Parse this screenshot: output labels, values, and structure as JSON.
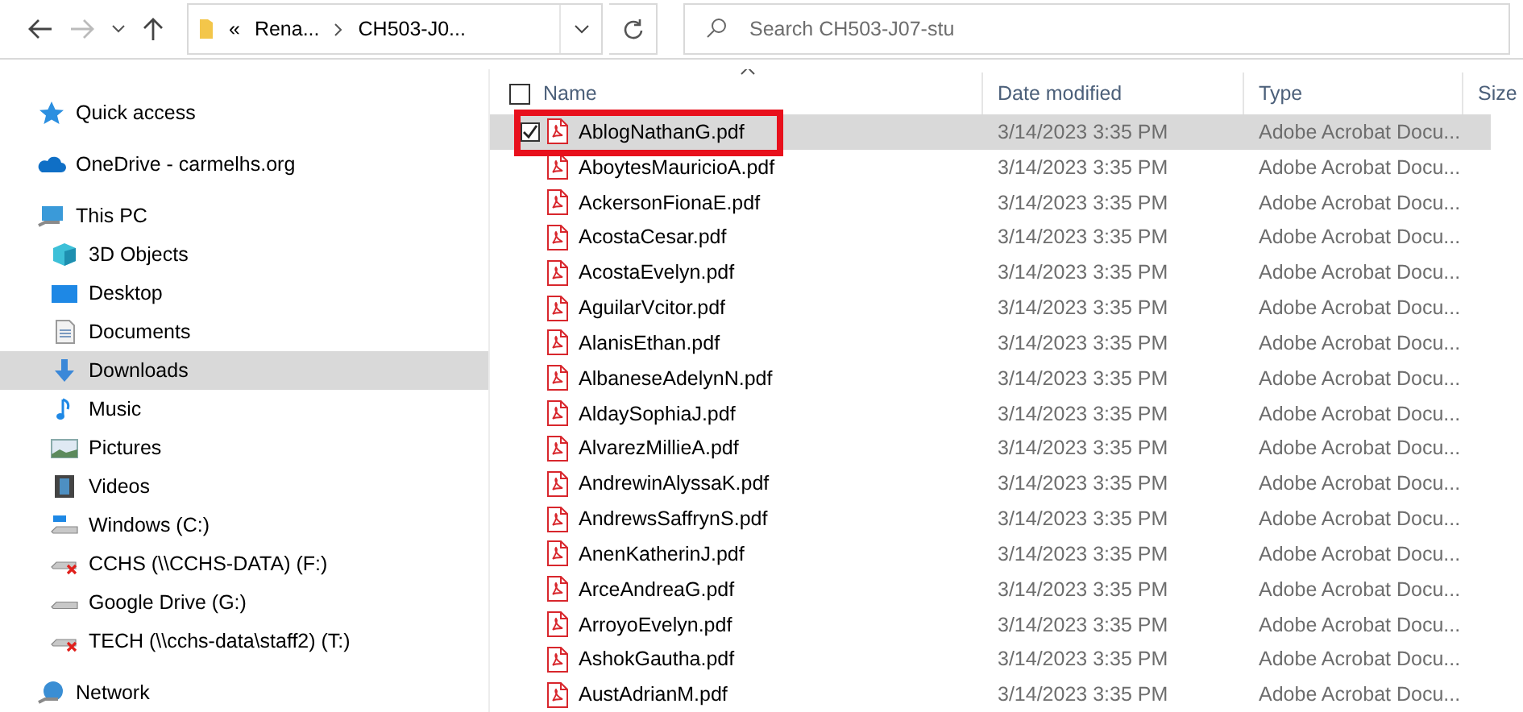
{
  "toolbar": {
    "address": {
      "overflow": "«",
      "segments": [
        "Rena...",
        "CH503-J0..."
      ]
    },
    "search": {
      "placeholder": "Search CH503-J07-stu"
    }
  },
  "navigation": [
    {
      "kind": "quick",
      "label": "Quick access",
      "selected": false
    },
    {
      "kind": "cloud",
      "label": "OneDrive - carmelhs.org",
      "selected": false
    },
    {
      "kind": "pc",
      "label": "This PC",
      "selected": false,
      "children": [
        {
          "kind": "objects",
          "label": "3D Objects",
          "selected": false
        },
        {
          "kind": "desktop",
          "label": "Desktop",
          "selected": false
        },
        {
          "kind": "documents",
          "label": "Documents",
          "selected": false
        },
        {
          "kind": "downloads",
          "label": "Downloads",
          "selected": true
        },
        {
          "kind": "music",
          "label": "Music",
          "selected": false
        },
        {
          "kind": "pictures",
          "label": "Pictures",
          "selected": false
        },
        {
          "kind": "videos",
          "label": "Videos",
          "selected": false
        },
        {
          "kind": "drive",
          "label": "Windows (C:)",
          "selected": false
        },
        {
          "kind": "offline-drive",
          "label": "CCHS (\\\\CCHS-DATA) (F:)",
          "selected": false
        },
        {
          "kind": "plain-drive",
          "label": "Google Drive (G:)",
          "selected": false
        },
        {
          "kind": "offline-drive",
          "label": "TECH (\\\\cchs-data\\staff2) (T:)",
          "selected": false
        }
      ]
    },
    {
      "kind": "network",
      "label": "Network",
      "selected": false
    }
  ],
  "file_list": {
    "select_all_checked": false,
    "columns": [
      "Name",
      "Date modified",
      "Type",
      "Size"
    ],
    "files": [
      {
        "name": "AblogNathanG.pdf",
        "date": "3/14/2023 3:35 PM",
        "type": "Adobe Acrobat Docu...",
        "selected": true,
        "checked": true,
        "highlighted": true
      },
      {
        "name": "AboytesMauricioA.pdf",
        "date": "3/14/2023 3:35 PM",
        "type": "Adobe Acrobat Docu...",
        "selected": false,
        "checked": false,
        "highlighted": false
      },
      {
        "name": "AckersonFionaE.pdf",
        "date": "3/14/2023 3:35 PM",
        "type": "Adobe Acrobat Docu...",
        "selected": false,
        "checked": false,
        "highlighted": false
      },
      {
        "name": "AcostaCesar.pdf",
        "date": "3/14/2023 3:35 PM",
        "type": "Adobe Acrobat Docu...",
        "selected": false,
        "checked": false,
        "highlighted": false
      },
      {
        "name": "AcostaEvelyn.pdf",
        "date": "3/14/2023 3:35 PM",
        "type": "Adobe Acrobat Docu...",
        "selected": false,
        "checked": false,
        "highlighted": false
      },
      {
        "name": "AguilarVcitor.pdf",
        "date": "3/14/2023 3:35 PM",
        "type": "Adobe Acrobat Docu...",
        "selected": false,
        "checked": false,
        "highlighted": false
      },
      {
        "name": "AlanisEthan.pdf",
        "date": "3/14/2023 3:35 PM",
        "type": "Adobe Acrobat Docu...",
        "selected": false,
        "checked": false,
        "highlighted": false
      },
      {
        "name": "AlbaneseAdelynN.pdf",
        "date": "3/14/2023 3:35 PM",
        "type": "Adobe Acrobat Docu...",
        "selected": false,
        "checked": false,
        "highlighted": false
      },
      {
        "name": "AldaySophiaJ.pdf",
        "date": "3/14/2023 3:35 PM",
        "type": "Adobe Acrobat Docu...",
        "selected": false,
        "checked": false,
        "highlighted": false
      },
      {
        "name": "AlvarezMillieA.pdf",
        "date": "3/14/2023 3:35 PM",
        "type": "Adobe Acrobat Docu...",
        "selected": false,
        "checked": false,
        "highlighted": false
      },
      {
        "name": "AndrewinAlyssaK.pdf",
        "date": "3/14/2023 3:35 PM",
        "type": "Adobe Acrobat Docu...",
        "selected": false,
        "checked": false,
        "highlighted": false
      },
      {
        "name": "AndrewsSaffrynS.pdf",
        "date": "3/14/2023 3:35 PM",
        "type": "Adobe Acrobat Docu...",
        "selected": false,
        "checked": false,
        "highlighted": false
      },
      {
        "name": "AnenKatherinJ.pdf",
        "date": "3/14/2023 3:35 PM",
        "type": "Adobe Acrobat Docu...",
        "selected": false,
        "checked": false,
        "highlighted": false
      },
      {
        "name": "ArceAndreaG.pdf",
        "date": "3/14/2023 3:35 PM",
        "type": "Adobe Acrobat Docu...",
        "selected": false,
        "checked": false,
        "highlighted": false
      },
      {
        "name": "ArroyoEvelyn.pdf",
        "date": "3/14/2023 3:35 PM",
        "type": "Adobe Acrobat Docu...",
        "selected": false,
        "checked": false,
        "highlighted": false
      },
      {
        "name": "AshokGautha.pdf",
        "date": "3/14/2023 3:35 PM",
        "type": "Adobe Acrobat Docu...",
        "selected": false,
        "checked": false,
        "highlighted": false
      },
      {
        "name": "AustAdrianM.pdf",
        "date": "3/14/2023 3:35 PM",
        "type": "Adobe Acrobat Docu...",
        "selected": false,
        "checked": false,
        "highlighted": false
      }
    ]
  }
}
